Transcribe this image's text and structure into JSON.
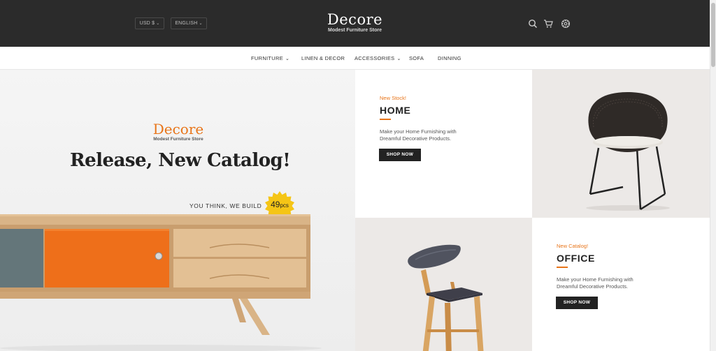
{
  "header": {
    "currency": "USD $",
    "language": "ENGLISH",
    "brand": "Decore",
    "tagline": "Modest Furniture Store",
    "icons": [
      "search-icon",
      "cart-icon",
      "gear-icon"
    ]
  },
  "nav": {
    "items": [
      {
        "label": "FURNITURE",
        "dropdown": true
      },
      {
        "label": "LINEN & DECOR",
        "dropdown": false
      },
      {
        "label": "ACCESSORIES",
        "dropdown": true
      },
      {
        "label": "SOFA",
        "dropdown": false
      },
      {
        "label": "DINNING",
        "dropdown": false
      }
    ]
  },
  "hero": {
    "brand": "Decore",
    "tagline": "Modest Furniture Store",
    "title": "Release, New Catalog!",
    "tag": "YOU THINK, WE BUILD",
    "badge_number": "49",
    "badge_unit": "pcs"
  },
  "cards": [
    {
      "kicker": "New Stock!",
      "title": "HOME",
      "desc": "Make your Home Furnishing with Dreamful Decorative Products.",
      "button": "SHOP NOW"
    },
    {
      "kicker": "New Catalog!",
      "title": "OFFICE",
      "desc": "Make your Home Furnishing with Dreamful Decorative Products.",
      "button": "SHOP NOW"
    }
  ],
  "colors": {
    "accent": "#e8751a",
    "header_bg": "#2b2b2b",
    "dark": "#222222"
  }
}
